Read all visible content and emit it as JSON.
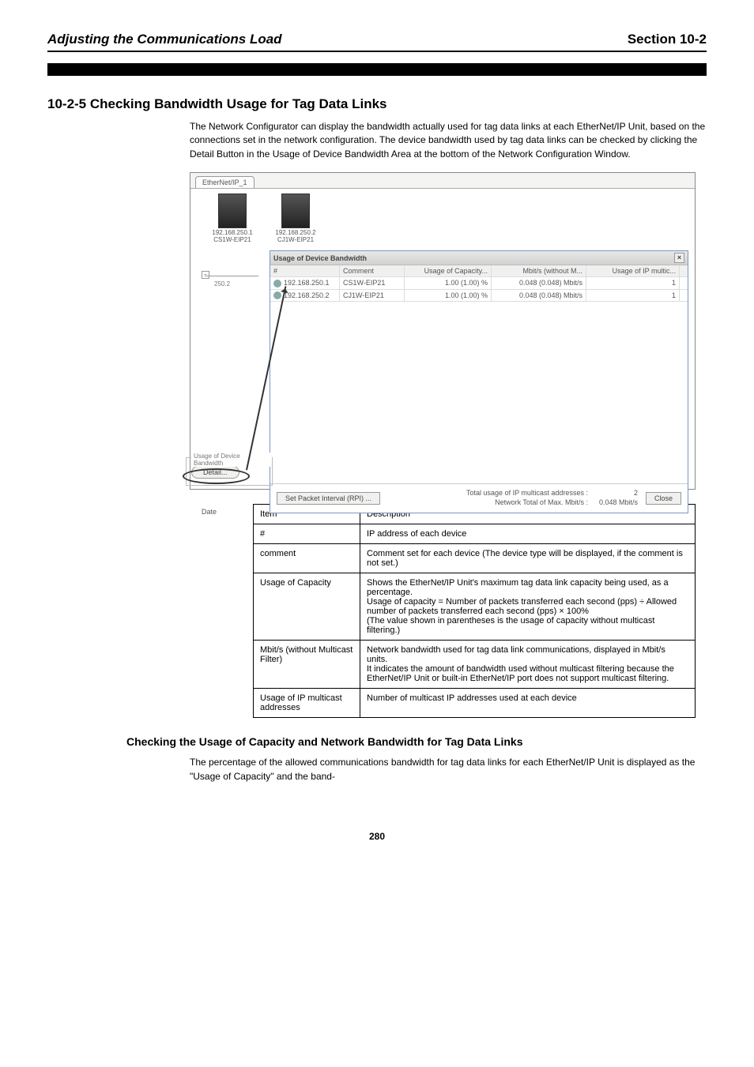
{
  "header": {
    "left": "Adjusting the Communications Load",
    "right": "Section 10-2"
  },
  "section_title": "10-2-5 Checking Bandwidth Usage for Tag Data Links",
  "para1": "The Network Configurator can display the bandwidth actually used for tag data links at each EtherNet/IP Unit, based on the connections set in the network configuration. The device bandwidth used by tag data links can be checked by clicking the Detail Button in the Usage of Device Bandwidth Area at the bottom of the Network Configuration Window.",
  "screenshot": {
    "tab": "EtherNet/IP_1",
    "dev1": {
      "ip": "192.168.250.1",
      "model": "CS1W-EIP21"
    },
    "dev2": {
      "ip": "192.168.250.2",
      "model": "CJ1W-EIP21"
    },
    "sub_expand": "−",
    "sub_label": "250.2",
    "group_label": "Usage of Device Bandwidth",
    "detail_btn": "Detail...",
    "date_label": "Date",
    "dialog": {
      "title": "Usage of Device Bandwidth",
      "close": "×",
      "cols": {
        "ip": "#",
        "cm": "Comment",
        "uc": "Usage of Capacity...",
        "mb": "Mbit/s (without M...",
        "mu": "Usage of IP multic..."
      },
      "rows": [
        {
          "ip": "192.168.250.1",
          "cm": "CS1W-EIP21",
          "uc": "1.00 (1.00) %",
          "mb": "0.048 (0.048) Mbit/s",
          "mu": "1"
        },
        {
          "ip": "192.168.250.2",
          "cm": "CJ1W-EIP21",
          "uc": "1.00 (1.00) %",
          "mb": "0.048 (0.048) Mbit/s",
          "mu": "1"
        }
      ],
      "set_btn": "Set Packet Interval (RPI) ...",
      "total_lbl": "Total usage of IP multicast addresses :",
      "total_val": "2",
      "net_lbl": "Network Total of Max. Mbit/s :",
      "net_val": "0.048 Mbit/s",
      "close_btn": "Close"
    }
  },
  "table": {
    "rows": [
      {
        "k": "Item",
        "v": "Description"
      },
      {
        "k": "#",
        "v": "IP address of each device"
      },
      {
        "k": "comment",
        "v": "Comment set for each device (The device type will be displayed, if the comment is not set.)"
      },
      {
        "k": "Usage of Capacity",
        "v": "Shows the EtherNet/IP Unit's maximum tag data link capacity being used, as a percentage.\nUsage of capacity = Number of packets transferred each second (pps) ÷ Allowed number of packets transferred each second (pps) × 100%\n(The value shown in parentheses is the usage of capacity without multicast filtering.)"
      },
      {
        "k": "Mbit/s (without Multicast Filter)",
        "v": "Network bandwidth used for tag data link communications, displayed in Mbit/s units.\nIt indicates the amount of bandwidth used without multicast filtering because the EtherNet/IP Unit or built-in EtherNet/IP port does not support multicast filtering."
      },
      {
        "k": "Usage of IP multicast addresses",
        "v": "Number of multicast IP addresses used at each device"
      }
    ]
  },
  "sub_head": "Checking the Usage of Capacity and Network Bandwidth for Tag Data Links",
  "para2": "The percentage of the allowed communications bandwidth for tag data links for each EtherNet/IP Unit is displayed as the \"Usage of Capacity\" and the band-",
  "footer": "280"
}
